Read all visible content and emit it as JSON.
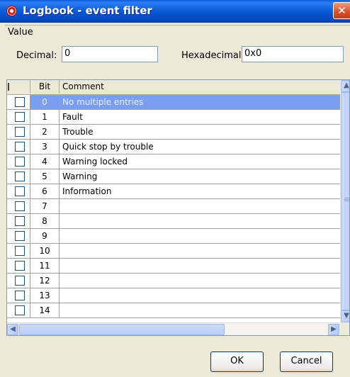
{
  "window": {
    "title": "Logbook - event filter",
    "close_glyph": "✕"
  },
  "value_group": {
    "label": "Value",
    "decimal_label": "Decimal:",
    "decimal_value": "0",
    "hex_label": "Hexadecimal:",
    "hex_value": "0x0"
  },
  "grid": {
    "columns": {
      "check": "",
      "bit": "Bit",
      "comment": "Comment"
    },
    "rows": [
      {
        "bit": "0",
        "comment": "No multiple entries",
        "checked": false,
        "selected": true
      },
      {
        "bit": "1",
        "comment": "Fault",
        "checked": false
      },
      {
        "bit": "2",
        "comment": "Trouble",
        "checked": false
      },
      {
        "bit": "3",
        "comment": "Quick stop by trouble",
        "checked": false
      },
      {
        "bit": "4",
        "comment": "Warning locked",
        "checked": false
      },
      {
        "bit": "5",
        "comment": "Warning",
        "checked": false
      },
      {
        "bit": "6",
        "comment": "Information",
        "checked": false
      },
      {
        "bit": "7",
        "comment": "",
        "checked": false
      },
      {
        "bit": "8",
        "comment": "",
        "checked": false
      },
      {
        "bit": "9",
        "comment": "",
        "checked": false
      },
      {
        "bit": "10",
        "comment": "",
        "checked": false
      },
      {
        "bit": "11",
        "comment": "",
        "checked": false
      },
      {
        "bit": "12",
        "comment": "",
        "checked": false
      },
      {
        "bit": "13",
        "comment": "",
        "checked": false
      },
      {
        "bit": "14",
        "comment": "",
        "checked": false
      }
    ]
  },
  "buttons": {
    "ok": "OK",
    "cancel": "Cancel"
  },
  "icons": {
    "app": "app-icon",
    "close": "close-icon",
    "scroll_up": "chevron-up-icon",
    "scroll_down": "chevron-down-icon",
    "scroll_left": "chevron-left-icon",
    "scroll_right": "chevron-right-icon"
  },
  "colors": {
    "title_bar": "#0a5fd8",
    "selection": "#7b9ef0",
    "dialog_bg": "#ece9d8"
  }
}
